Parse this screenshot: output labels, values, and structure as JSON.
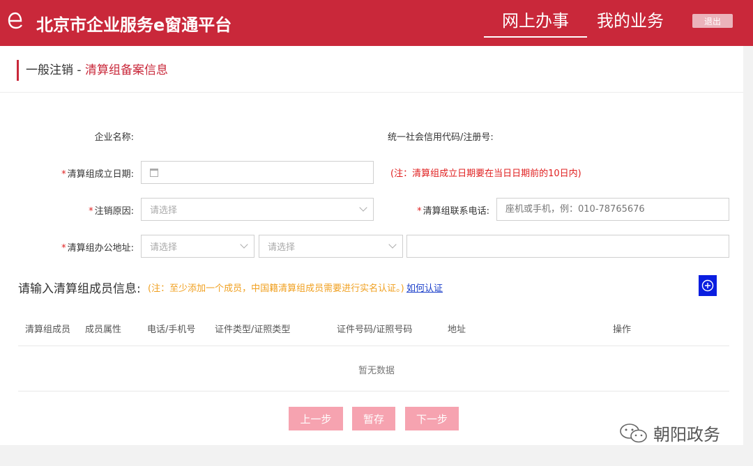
{
  "header": {
    "logo_glyph": "e",
    "platform_name": "北京市企业服务e窗通平台",
    "nav": [
      {
        "label": "网上办事",
        "active": true
      },
      {
        "label": "我的业务",
        "active": false
      }
    ],
    "logout_label": "退出",
    "brand_color": "#c9283a"
  },
  "breadcrumb": {
    "main": "一般注销",
    "separator": " - ",
    "sub": "清算组备案信息"
  },
  "form": {
    "required_mark": "*",
    "company_name_label": "企业名称:",
    "credit_code_label": "统一社会信用代码/注册号:",
    "established_date_label": "清算组成立日期:",
    "established_date_value": "",
    "established_date_note": "(注：清算组成立日期要在当日日期前的10日内)",
    "cancel_reason_label": "注销原因:",
    "cancel_reason_placeholder": "请选择",
    "phone_label": "清算组联系电话:",
    "phone_placeholder": "座机或手机，例：010-78765676",
    "office_address_label": "清算组办公地址:",
    "address_select1_placeholder": "请选择",
    "address_select2_placeholder": "请选择",
    "address_detail_value": ""
  },
  "members": {
    "title": "请输入清算组成员信息:",
    "note": "(注：至少添加一个成员，中国籍清算组成员需要进行实名认证。)",
    "how_link": "如何认证",
    "add_icon": "plus-circle-icon",
    "columns": [
      "清算组成员",
      "成员属性",
      "电话/手机号",
      "证件类型/证照类型",
      "证件号码/证照号码",
      "地址",
      "操作"
    ],
    "empty_text": "暂无数据"
  },
  "actions": {
    "prev_label": "上一步",
    "save_label": "暂存",
    "next_label": "下一步",
    "disabled_color": "#f6a3b0"
  },
  "watermark": {
    "icon": "wechat-icon",
    "text": "朝阳政务"
  }
}
